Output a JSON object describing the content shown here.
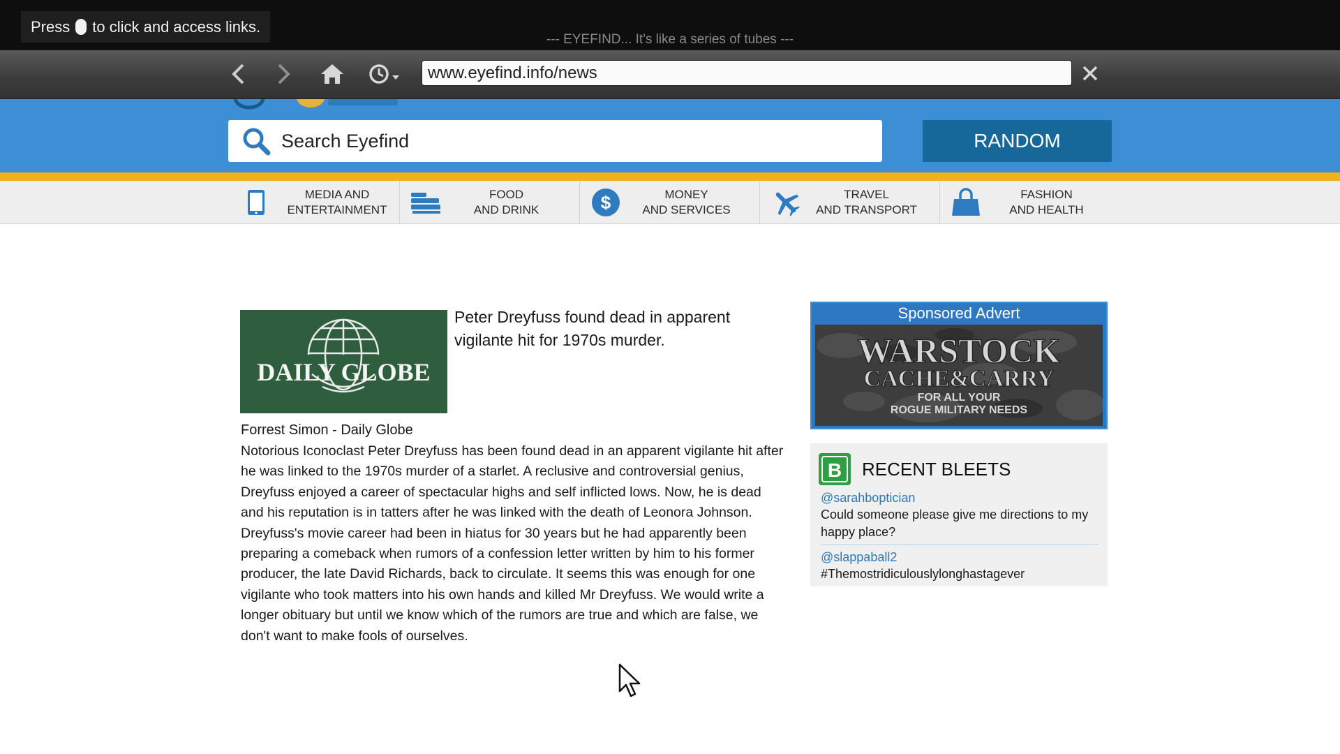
{
  "overlay": {
    "hint_before": "Press",
    "hint_after": "to click and access links.",
    "tagline": "--- EYEFIND... It's like a series of tubes ---"
  },
  "browser": {
    "url": "www.eyefind.info/news",
    "icons": [
      "back-arrow-icon",
      "forward-arrow-icon",
      "home-icon",
      "history-clock-icon",
      "close-icon"
    ]
  },
  "header": {
    "search_placeholder": "Search Eyefind",
    "random_label": "RANDOM",
    "colors": {
      "header_blue": "#3c8fd4",
      "random_blue": "#16679a",
      "stripe_yellow": "#f0b21a"
    }
  },
  "categories": [
    {
      "line1": "MEDIA AND",
      "line2": "ENTERTAINMENT",
      "icon": "phone-icon"
    },
    {
      "line1": "FOOD",
      "line2": "AND DRINK",
      "icon": "food-tray-icon"
    },
    {
      "line1": "MONEY",
      "line2": "AND SERVICES",
      "icon": "dollar-icon"
    },
    {
      "line1": "TRAVEL",
      "line2": "AND TRANSPORT",
      "icon": "airplane-icon"
    },
    {
      "line1": "FASHION",
      "line2": "AND HEALTH",
      "icon": "shopping-bag-icon"
    }
  ],
  "article": {
    "logo_text": "DAILY GLOBE",
    "headline": "Peter Dreyfuss found dead in apparent vigilante hit for 1970s murder.",
    "byline": "Forrest Simon - Daily Globe",
    "body": "Notorious Iconoclast Peter Dreyfuss has been found dead in an apparent vigilante hit after he was linked to the 1970s murder of a starlet. A reclusive and controversial genius, Dreyfuss enjoyed a career of spectacular highs and self inflicted lows. Now, he is dead and his reputation is in tatters after he was linked with the death of Leonora Johnson. Dreyfuss's movie career had been in hiatus for 30 years but he had apparently been preparing a comeback when rumors of a confession letter written by him to his former producer, the late David Richards, back to circulate. It seems this was enough for one vigilante who took matters into his own hands and killed Mr Dreyfuss. We would write a longer obituary but until we know which of the rumors are true and which are false, we don't want to make fools of ourselves."
  },
  "advert": {
    "label": "Sponsored Advert",
    "line1": "WARSTOCK",
    "line2": "CACHE&CARRY",
    "line3": "FOR ALL YOUR",
    "line4": "ROGUE MILITARY NEEDS"
  },
  "bleets": {
    "title": "RECENT BLEETS",
    "items": [
      {
        "user": "@sarahboptician",
        "text": "Could someone please give me directions to my happy place?"
      },
      {
        "user": "@slappaball2",
        "text": "#Themostridiculouslylonghastagever"
      }
    ]
  }
}
